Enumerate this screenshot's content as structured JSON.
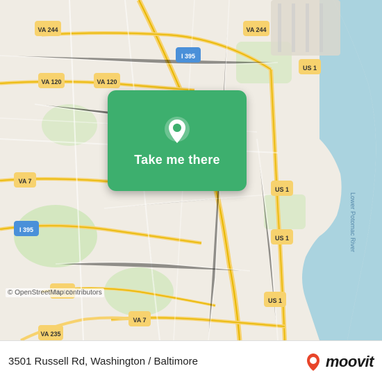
{
  "map": {
    "attribution": "© OpenStreetMap contributors",
    "background_color": "#e8e0d8"
  },
  "popup": {
    "button_label": "Take me there",
    "pin_icon": "location-pin"
  },
  "bottom_bar": {
    "address": "3501 Russell Rd, Washington / Baltimore",
    "logo_text": "moovit"
  }
}
